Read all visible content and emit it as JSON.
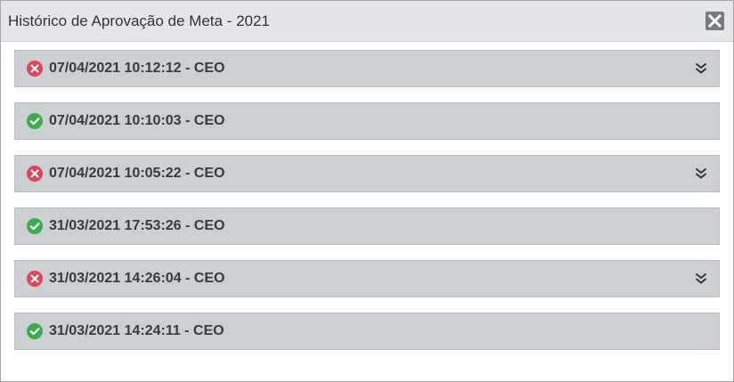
{
  "dialog": {
    "title": "Histórico de Aprovação de Meta - 2021",
    "close_icon": "close-icon"
  },
  "colors": {
    "rejected": "#e2445c",
    "approved": "#3aad4e",
    "row_bg": "#cdd0d3",
    "titlebar_bg": "#e4e6e9"
  },
  "history": [
    {
      "label": "07/04/2021 10:12:12 - CEO",
      "status": "rejected",
      "status_icon": "x-circle-icon",
      "expandable": true,
      "expand_icon": "double-chevron-down-icon"
    },
    {
      "label": "07/04/2021 10:10:03 - CEO",
      "status": "approved",
      "status_icon": "check-circle-icon",
      "expandable": false
    },
    {
      "label": "07/04/2021 10:05:22 - CEO",
      "status": "rejected",
      "status_icon": "x-circle-icon",
      "expandable": true,
      "expand_icon": "double-chevron-down-icon"
    },
    {
      "label": "31/03/2021 17:53:26 - CEO",
      "status": "approved",
      "status_icon": "check-circle-icon",
      "expandable": false
    },
    {
      "label": "31/03/2021 14:26:04 - CEO",
      "status": "rejected",
      "status_icon": "x-circle-icon",
      "expandable": true,
      "expand_icon": "double-chevron-down-icon"
    },
    {
      "label": "31/03/2021 14:24:11 - CEO",
      "status": "approved",
      "status_icon": "check-circle-icon",
      "expandable": false
    }
  ]
}
